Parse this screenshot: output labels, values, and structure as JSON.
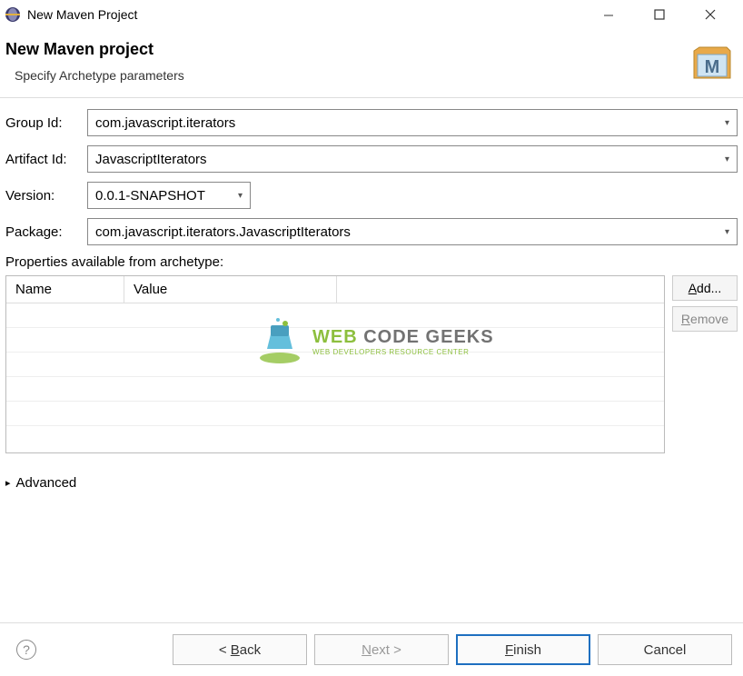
{
  "window": {
    "title": "New Maven Project"
  },
  "header": {
    "heading": "New Maven project",
    "subheading": "Specify Archetype parameters"
  },
  "form": {
    "group_id_label": "Group Id:",
    "group_id_value": "com.javascript.iterators",
    "artifact_id_label": "Artifact Id:",
    "artifact_id_value": "JavascriptIterators",
    "version_label": "Version:",
    "version_value": "0.0.1-SNAPSHOT",
    "package_label": "Package:",
    "package_value": "com.javascript.iterators.JavascriptIterators"
  },
  "properties": {
    "section_label": "Properties available from archetype:",
    "columns": {
      "name": "Name",
      "value": "Value"
    },
    "buttons": {
      "add": "Add...",
      "remove": "Remove"
    }
  },
  "advanced": {
    "label": "Advanced"
  },
  "buttons": {
    "back": "< Back",
    "next": "Next >",
    "finish": "Finish",
    "cancel": "Cancel"
  },
  "watermark": {
    "title_part1": "WEB ",
    "title_part2": "CODE GEEKS",
    "subtitle": "WEB DEVELOPERS RESOURCE CENTER"
  }
}
